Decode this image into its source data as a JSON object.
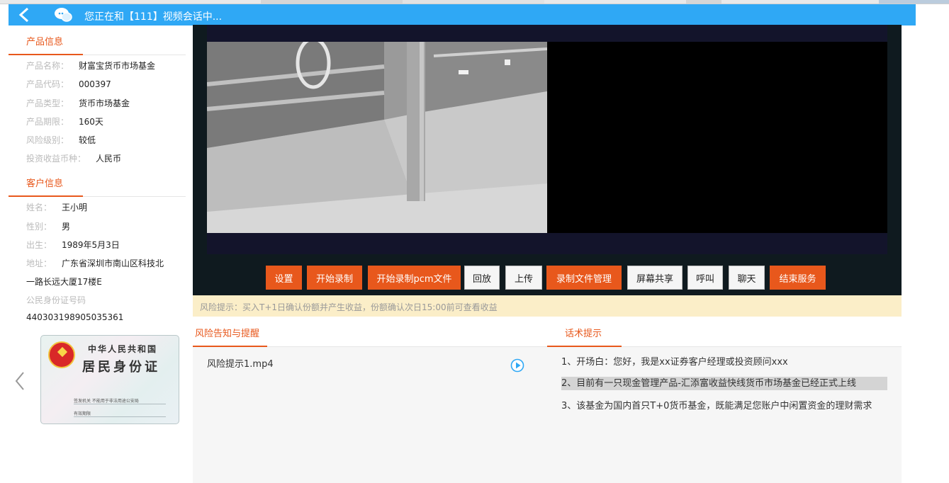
{
  "window": {
    "title": "您正在和【111】视频会话中..."
  },
  "product": {
    "section_title": "产品信息",
    "fields": [
      {
        "label": "产品名称：",
        "value": "财富宝货币市场基金"
      },
      {
        "label": "产品代码：",
        "value": "000397"
      },
      {
        "label": "产品类型：",
        "value": "货币市场基金"
      },
      {
        "label": "产品期限：",
        "value": "160天"
      },
      {
        "label": "风险级别：",
        "value": "较低"
      },
      {
        "label": "投资收益币种：",
        "value": "人民币"
      }
    ]
  },
  "customer": {
    "section_title": "客户信息",
    "name_label": "姓名：",
    "name": "王小明",
    "gender_label": "性别：",
    "gender": "男",
    "birth_label": "出生：",
    "birth": "1989年5月3日",
    "address_label": "地址：",
    "address_line1": "广东省深圳市南山区科技北",
    "address_line2": "一路长远大厦17楼E",
    "id_label": "公民身份证号码",
    "id_number": "440303198905035361"
  },
  "id_card": {
    "country": "中华人民共和国",
    "card_title": "居民身份证",
    "issuer_line": "签发机关  不能用于非法用途公安局",
    "valid_line": "有效期限"
  },
  "toolbar": {
    "settings": "设置",
    "start_record": "开始录制",
    "start_pcm": "开始录制pcm文件",
    "playback": "回放",
    "upload": "上传",
    "record_manage": "录制文件管理",
    "screen_share": "屏幕共享",
    "call": "呼叫",
    "chat": "聊天",
    "end_service": "结束服务"
  },
  "risk_tip": "风险提示：买入T+1日确认份额并产生收益，份额确认次日15:00前可查看收益",
  "risk_panel": {
    "title": "风险告知与提醒",
    "file": "风险提示1.mp4"
  },
  "script_panel": {
    "title": "话术提示",
    "lines": [
      "1、开场白：您好，我是xx证券客户经理或投资顾问xxx",
      "2、目前有一只现金管理产品-汇添富收益快线货币市场基金已经正式上线",
      "3、该基金为国内首只T+0货币基金，既能满足您账户中闲置资金的理财需求"
    ]
  },
  "colors": {
    "accent": "#e8581c",
    "titlebar": "#2fa8f5",
    "tip_bg": "#fbeec8"
  }
}
